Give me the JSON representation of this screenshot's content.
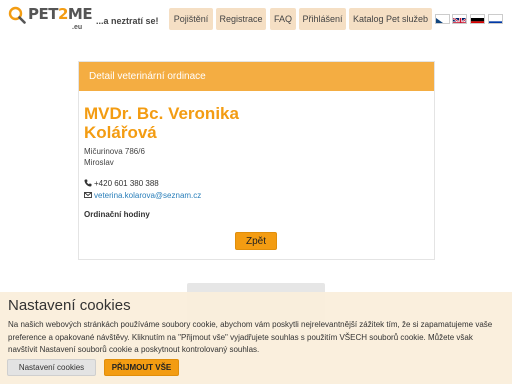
{
  "header": {
    "logo_text_a": "PET",
    "logo_text_b": "2",
    "logo_text_c": "ME",
    "logo_sub": ".eu",
    "tagline": "...a neztratí se!",
    "nav": {
      "insurance": "Pojištění",
      "registration": "Registrace",
      "faq": "FAQ",
      "login": "Přihlášení",
      "catalog": "Katalog Pet služeb"
    },
    "languages": [
      "cs",
      "en",
      "de",
      "ru"
    ]
  },
  "card": {
    "header": "Detail veterinární ordinace",
    "name": "MVDr. Bc. Veronika Kolářová",
    "street": "Mičurinova 786/6",
    "city": "Miroslav",
    "phone": "+420 601 380 388",
    "email": "veterina.kolarova@seznam.cz",
    "hours_title": "Ordinační hodiny",
    "back_label": "Zpět"
  },
  "cookies": {
    "title": "Nastavení cookies",
    "text": "Na našich webových stránkách používáme soubory cookie, abychom vám poskytli nejrelevantnější zážitek tím, že si zapamatujeme vaše preference a opakované návštěvy. Kliknutím na \"Přijmout vše\" vyjadřujete souhlas s použitím VŠECH souborů cookie. Můžete však navštívit Nastavení souborů cookie a poskytnout kontrolovaný souhlas.",
    "settings_label": "Nastavení cookies",
    "accept_label": "PŘIJMOUT VŠE"
  },
  "colors": {
    "accent": "#f39c12",
    "header_bar": "#f4ad42",
    "nav_bg": "#f5dfc4",
    "cookie_bg": "#faeedc",
    "link": "#2a7fba"
  }
}
